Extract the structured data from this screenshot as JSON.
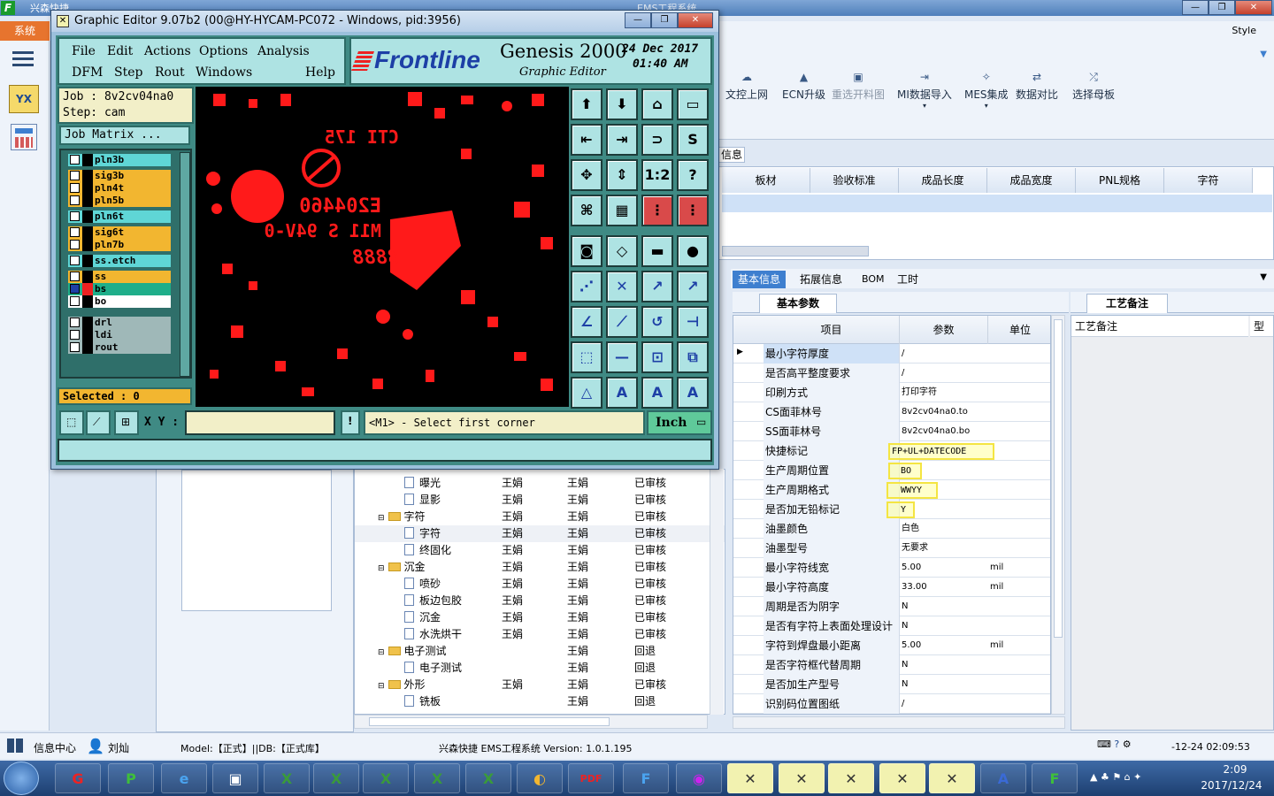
{
  "ems": {
    "app_title": "兴森快捷",
    "window_title": "EMS工程系统",
    "sys_menu": "系统",
    "style_label": "Style",
    "yx_label": "YX",
    "ribbon": [
      {
        "label": "文控上网",
        "icon": "cloud-upload-icon"
      },
      {
        "label": "ECN升级",
        "icon": "ecn-icon"
      },
      {
        "label": "重选开料图",
        "icon": "image-icon"
      },
      {
        "label": "MI数据导入",
        "icon": "import-icon"
      },
      {
        "label": "MES集成",
        "icon": "integrate-icon"
      },
      {
        "label": "数据对比",
        "icon": "compare-icon"
      },
      {
        "label": "选择母板",
        "icon": "shuffle-icon"
      }
    ],
    "info_tab": "信息",
    "grid_headers": [
      "板材",
      "验收标准",
      "成品长度",
      "成品宽度",
      "PNL规格",
      "字符"
    ],
    "tabs": [
      "基本信息",
      "拓展信息",
      "BOM",
      "工时"
    ],
    "basic_params_tab": "基本参数",
    "process_notes_tab": "工艺备注",
    "process_notes_header": "工艺备注",
    "type_header": "型",
    "param_headers": [
      "项目",
      "参数",
      "单位"
    ],
    "params": [
      {
        "item": "最小字符厚度",
        "value": "/",
        "unit": ""
      },
      {
        "item": "是否高平整度要求",
        "value": "/",
        "unit": ""
      },
      {
        "item": "印刷方式",
        "value": "打印字符",
        "unit": ""
      },
      {
        "item": "CS面菲林号",
        "value": "8v2cv04na0.to",
        "unit": ""
      },
      {
        "item": "SS面菲林号",
        "value": "8v2cv04na0.bo",
        "unit": ""
      },
      {
        "item": "快捷标记",
        "value": "FP+UL+DATECODE",
        "unit": ""
      },
      {
        "item": "生产周期位置",
        "value": "BO",
        "unit": ""
      },
      {
        "item": "生产周期格式",
        "value": "WWYY",
        "unit": ""
      },
      {
        "item": "是否加无铅标记",
        "value": "Y",
        "unit": ""
      },
      {
        "item": "油墨颜色",
        "value": "白色",
        "unit": ""
      },
      {
        "item": "油墨型号",
        "value": "无要求",
        "unit": ""
      },
      {
        "item": "最小字符线宽",
        "value": "5.00",
        "unit": "mil"
      },
      {
        "item": "最小字符高度",
        "value": "33.00",
        "unit": "mil"
      },
      {
        "item": "周期是否为阴字",
        "value": "N",
        "unit": ""
      },
      {
        "item": "是否有字符上表面处理设计",
        "value": "N",
        "unit": ""
      },
      {
        "item": "字符到焊盘最小距离",
        "value": "5.00",
        "unit": "mil"
      },
      {
        "item": "是否字符框代替周期",
        "value": "N",
        "unit": ""
      },
      {
        "item": "是否加生产型号",
        "value": "N",
        "unit": ""
      },
      {
        "item": "识别码位置图纸",
        "value": "/",
        "unit": ""
      }
    ],
    "tree": [
      {
        "name": "曝光",
        "type": "doc",
        "a": "王娟",
        "b": "王娟",
        "s": "已审核"
      },
      {
        "name": "显影",
        "type": "doc",
        "a": "王娟",
        "b": "王娟",
        "s": "已审核"
      },
      {
        "name": "字符",
        "type": "folder",
        "a": "王娟",
        "b": "王娟",
        "s": "已审核"
      },
      {
        "name": "字符",
        "type": "doc",
        "a": "王娟",
        "b": "王娟",
        "s": "已审核"
      },
      {
        "name": "终固化",
        "type": "doc",
        "a": "王娟",
        "b": "王娟",
        "s": "已审核"
      },
      {
        "name": "沉金",
        "type": "folder",
        "a": "王娟",
        "b": "王娟",
        "s": "已审核"
      },
      {
        "name": "喷砂",
        "type": "doc",
        "a": "王娟",
        "b": "王娟",
        "s": "已审核"
      },
      {
        "name": "板边包胶",
        "type": "doc",
        "a": "王娟",
        "b": "王娟",
        "s": "已审核"
      },
      {
        "name": "沉金",
        "type": "doc",
        "a": "王娟",
        "b": "王娟",
        "s": "已审核"
      },
      {
        "name": "水洗烘干",
        "type": "doc",
        "a": "王娟",
        "b": "王娟",
        "s": "已审核"
      },
      {
        "name": "电子测试",
        "type": "folder",
        "a": "",
        "b": "王娟",
        "s": "回退"
      },
      {
        "name": "电子测试",
        "type": "doc",
        "a": "",
        "b": "王娟",
        "s": "回退"
      },
      {
        "name": "外形",
        "type": "folder",
        "a": "王娟",
        "b": "王娟",
        "s": "已审核"
      },
      {
        "name": "铣板",
        "type": "doc",
        "a": "",
        "b": "王娟",
        "s": "回退"
      }
    ],
    "status": {
      "info_center": "信息中心",
      "user": "刘灿",
      "model": "Model:【正式】||DB:【正式库】",
      "system": "兴森快捷 EMS工程系统 Version: 1.0.1.195",
      "clock": "-12-24 02:09:53"
    }
  },
  "genesis": {
    "window_title": "Graphic Editor 9.07b2 (00@HY-HYCAM-PC072 - Windows, pid:3956)",
    "menu_row1": [
      "File",
      "Edit",
      "Actions",
      "Options",
      "Analysis"
    ],
    "menu_row2": [
      "DFM",
      "Step",
      "Rout",
      "Windows",
      "Help"
    ],
    "brand": "Frontline",
    "product": "Genesis 2000",
    "subtitle": "Graphic Editor",
    "date": "24 Dec 2017",
    "time": "01:40 AM",
    "job": "Job : 8v2cv04na0",
    "step": "Step: cam",
    "job_matrix": "Job Matrix ...",
    "layers": [
      {
        "name": "pln3b",
        "color": "#5fd6d6"
      },
      {
        "name": "sig3b",
        "color": "#f2b630"
      },
      {
        "name": "pln4t",
        "color": "#f2b630"
      },
      {
        "name": "pln5b",
        "color": "#f2b630"
      },
      {
        "name": "pln6t",
        "color": "#5fd6d6"
      },
      {
        "name": "sig6t",
        "color": "#f2b630"
      },
      {
        "name": "pln7b",
        "color": "#f2b630"
      },
      {
        "name": "ss.etch",
        "color": "#5fd6d6"
      },
      {
        "name": "ss",
        "color": "#f2b630"
      },
      {
        "name": "bs",
        "color": "#1fae8a"
      },
      {
        "name": "bo",
        "color": "#ffffff"
      },
      {
        "name": "drl",
        "color": "#9fb8b8"
      },
      {
        "name": "ldi",
        "color": "#9fb8b8"
      },
      {
        "name": "rout",
        "color": "#9fb8b8"
      }
    ],
    "selected": "Selected : 0",
    "xy_label": "X Y :",
    "prompt": "<M1> - Select first corner",
    "units": "Inch",
    "pcb_text": {
      "line1": "CTI 175",
      "line2": "E204460",
      "line3": "M11 S 94V-0",
      "line4": "8888"
    }
  },
  "taskbar": {
    "time": "2:09",
    "date": "2017/12/24"
  }
}
